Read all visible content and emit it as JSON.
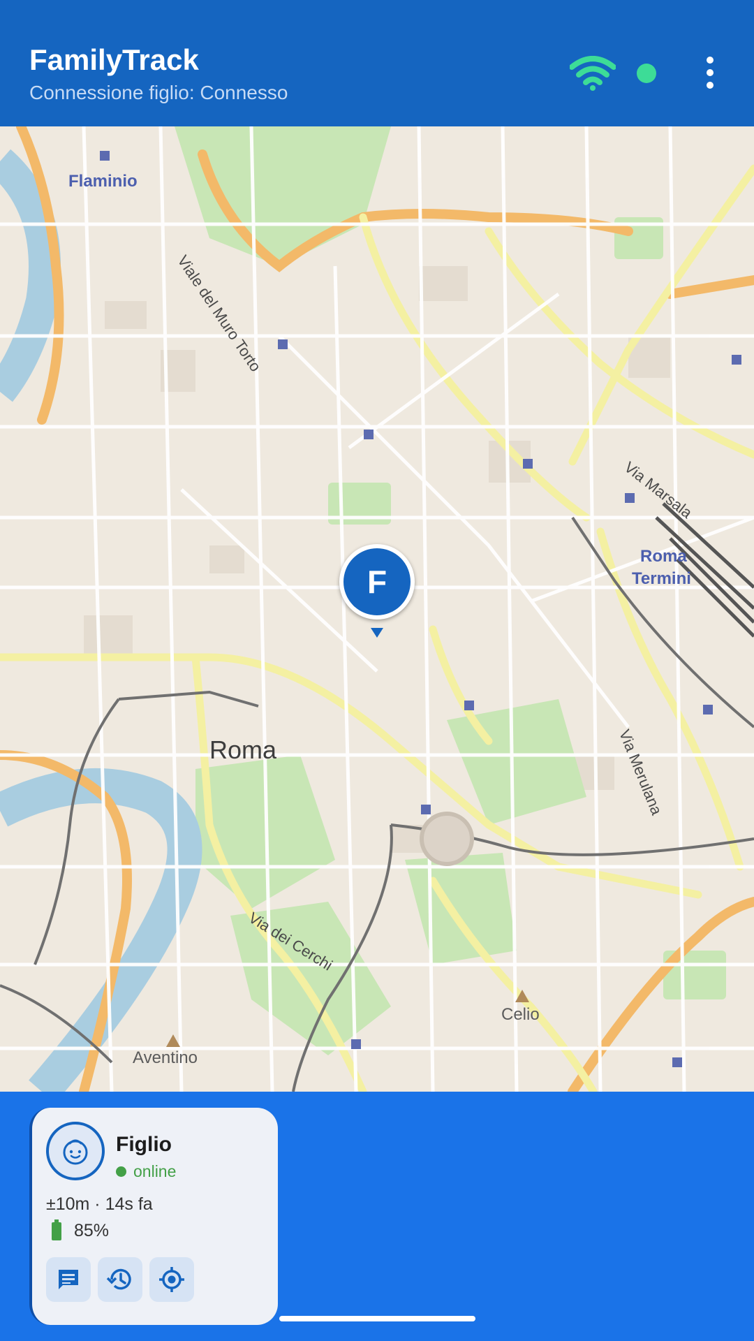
{
  "appbar": {
    "title": "FamilyTrack",
    "subtitle": "Connessione figlio: Connesso",
    "wifi_icon": "wifi-icon",
    "status_dot_color": "#3ddc97",
    "menu_icon": "more-vert-icon"
  },
  "map": {
    "labels": {
      "flaminio": "Flaminio",
      "viale_muro_torto": "Viale del Muro Torto",
      "via_marsala": "Via Marsala",
      "roma_termini_1": "Roma",
      "roma_termini_2": "Termini",
      "roma": "Roma",
      "via_merulana": "Via Merulana",
      "via_cerchi": "Via dei Cerchi",
      "celio": "Celio",
      "aventino": "Aventino"
    },
    "marker_letter": "F"
  },
  "card": {
    "name": "Figlio",
    "status": "online",
    "accuracy": "±10m · 14s fa",
    "battery": "85%",
    "battery_level": 0.85,
    "avatar_icon": "child-face-icon",
    "actions": [
      "message-icon",
      "history-icon",
      "locate-icon"
    ]
  },
  "colors": {
    "appbar": "#1565c0",
    "accent": "#1a73e8",
    "online": "#43a047"
  }
}
